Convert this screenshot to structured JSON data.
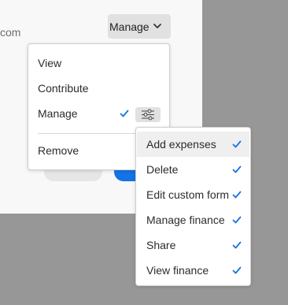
{
  "dialog": {
    "email_fragment": "com",
    "role_dropdown": {
      "value": "Manage"
    }
  },
  "role_menu": {
    "items": [
      {
        "label": "View",
        "checked": false
      },
      {
        "label": "Contribute",
        "checked": false
      },
      {
        "label": "Manage",
        "checked": true
      },
      {
        "label": "Remove",
        "checked": false
      }
    ]
  },
  "permissions_menu": {
    "items": [
      {
        "label": "Add expenses",
        "checked": true
      },
      {
        "label": "Delete",
        "checked": true
      },
      {
        "label": "Edit custom form",
        "checked": true
      },
      {
        "label": "Manage finance",
        "checked": true
      },
      {
        "label": "Share",
        "checked": true
      },
      {
        "label": "View finance",
        "checked": true
      }
    ]
  },
  "colors": {
    "accent": "#1473e6",
    "overlay": "#979797"
  },
  "icons": {
    "dropdown": "chevron-down-icon",
    "check": "checkmark-icon",
    "settings": "sliders-icon"
  }
}
